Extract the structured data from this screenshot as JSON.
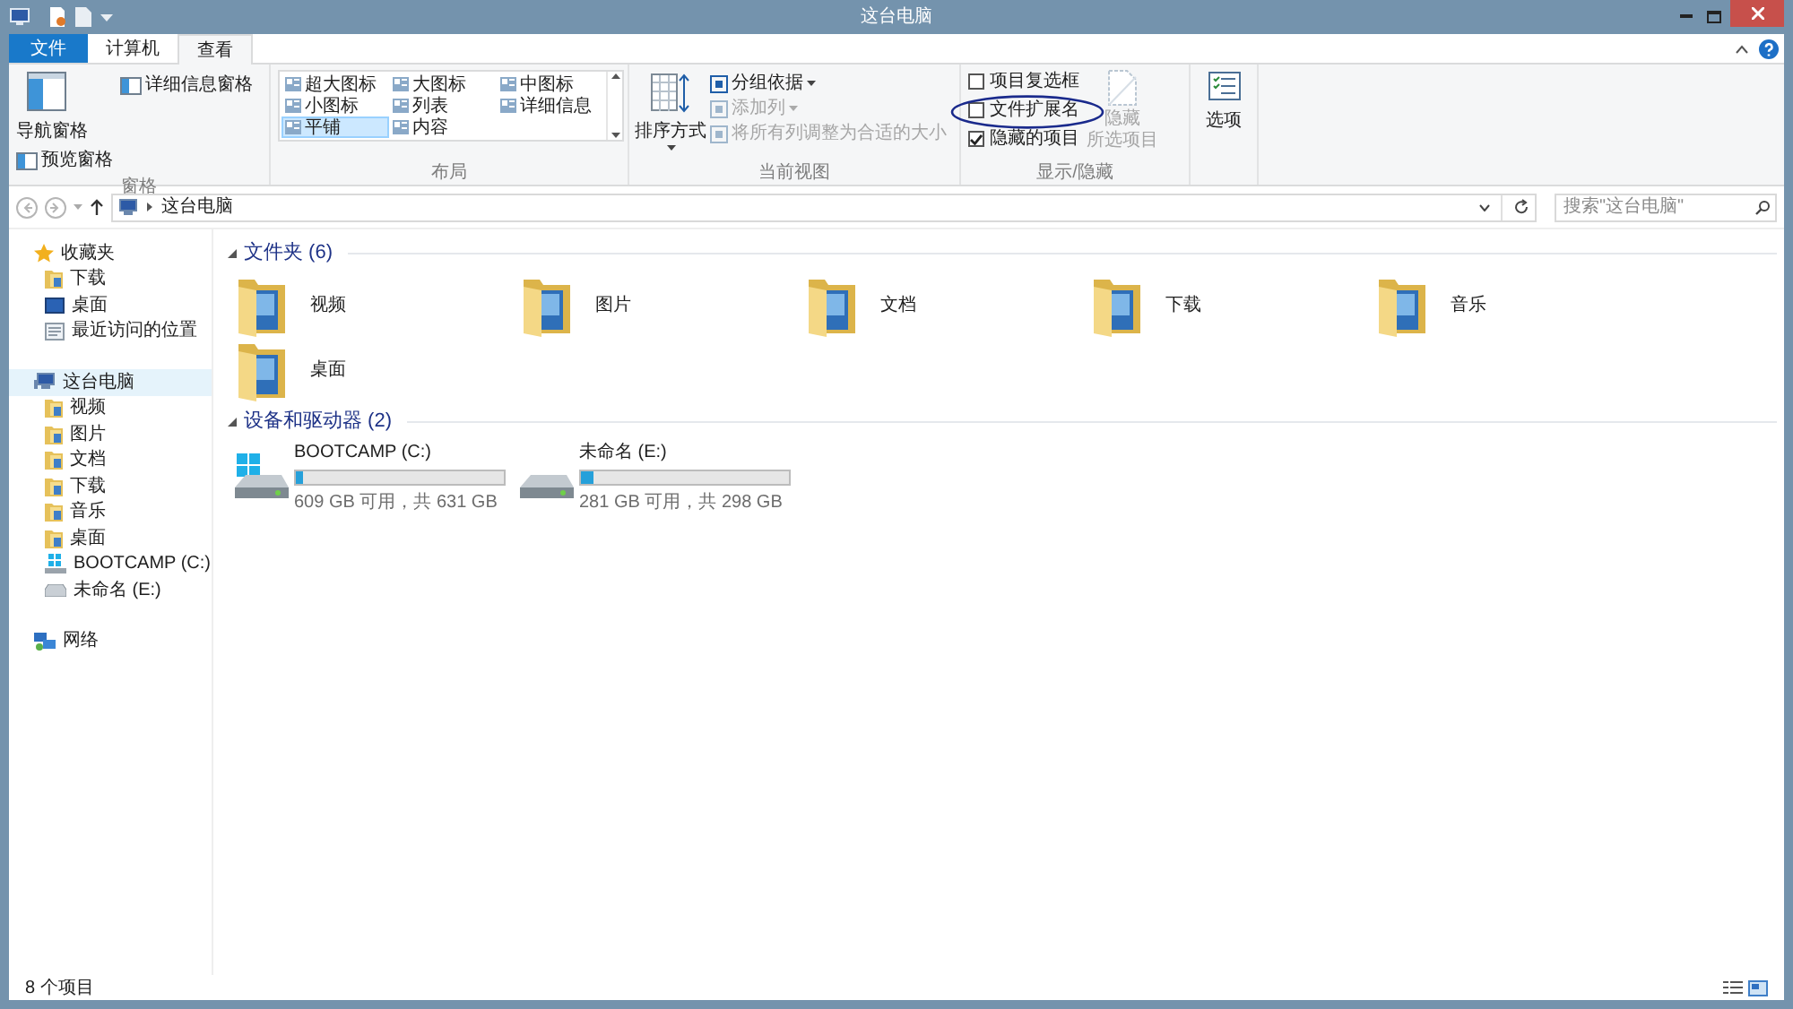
{
  "window": {
    "title": "这台电脑"
  },
  "tabs": [
    {
      "label": "文件",
      "kind": "file",
      "selected": false
    },
    {
      "label": "计算机",
      "kind": "tab",
      "selected": false
    },
    {
      "label": "查看",
      "kind": "tab",
      "selected": true
    }
  ],
  "ribbon": {
    "panes": {
      "label": "窗格",
      "navigation_pane": "导航窗格",
      "details_pane": "详细信息窗格",
      "preview_pane": "预览窗格"
    },
    "layout": {
      "label": "布局",
      "options": [
        {
          "label": "超大图标",
          "selected": false
        },
        {
          "label": "大图标",
          "selected": false
        },
        {
          "label": "中图标",
          "selected": false
        },
        {
          "label": "小图标",
          "selected": false
        },
        {
          "label": "列表",
          "selected": false
        },
        {
          "label": "详细信息",
          "selected": false
        },
        {
          "label": "平铺",
          "selected": true
        },
        {
          "label": "内容",
          "selected": false
        }
      ]
    },
    "current_view": {
      "label": "当前视图",
      "sort_by": "排序方式",
      "commands": [
        {
          "label": "分组依据",
          "disabled": false,
          "dropdown": true
        },
        {
          "label": "添加列",
          "disabled": true,
          "dropdown": true
        },
        {
          "label": "将所有列调整为合适的大小",
          "disabled": true,
          "dropdown": false
        }
      ]
    },
    "show_hide": {
      "label": "显示/隐藏",
      "checkboxes": [
        {
          "label": "项目复选框",
          "checked": false
        },
        {
          "label": "文件扩展名",
          "checked": false
        },
        {
          "label": "隐藏的项目",
          "checked": true
        }
      ],
      "hide_selected": {
        "lines": [
          "隐藏",
          "所选项目"
        ],
        "disabled": true
      }
    },
    "options": "选项"
  },
  "address_bar": {
    "path": "这台电脑",
    "search_placeholder": "搜索\"这台电脑\""
  },
  "sidebar": [
    {
      "label": "收藏夹",
      "kind": "star",
      "selected": false,
      "children": [
        {
          "label": "下载",
          "kind": "folder",
          "selected": false
        },
        {
          "label": "桌面",
          "kind": "desktop",
          "selected": false
        },
        {
          "label": "最近访问的位置",
          "kind": "recent",
          "selected": false
        }
      ]
    },
    {
      "label": "这台电脑",
      "kind": "computer",
      "selected": true,
      "children": [
        {
          "label": "视频",
          "kind": "folder",
          "selected": false
        },
        {
          "label": "图片",
          "kind": "folder",
          "selected": false
        },
        {
          "label": "文档",
          "kind": "folder",
          "selected": false
        },
        {
          "label": "下载",
          "kind": "folder",
          "selected": false
        },
        {
          "label": "音乐",
          "kind": "folder",
          "selected": false
        },
        {
          "label": "桌面",
          "kind": "folder",
          "selected": false
        },
        {
          "label": "BOOTCAMP (C:)",
          "kind": "windows_drive",
          "selected": false
        },
        {
          "label": "未命名 (E:)",
          "kind": "drive",
          "selected": false
        }
      ]
    },
    {
      "label": "网络",
      "kind": "network",
      "selected": false
    }
  ],
  "sections": [
    {
      "title": "文件夹 (6)",
      "kind": "folders",
      "items": [
        {
          "label": "视频"
        },
        {
          "label": "图片"
        },
        {
          "label": "文档"
        },
        {
          "label": "下载"
        },
        {
          "label": "音乐"
        },
        {
          "label": "桌面"
        }
      ]
    },
    {
      "title": "设备和驱动器 (2)",
      "kind": "drives",
      "items": [
        {
          "label": "BOOTCAMP (C:)",
          "kind": "windows_drive",
          "level": 0.035,
          "free": "609 GB 可用，共 631 GB"
        },
        {
          "label": "未命名 (E:)",
          "kind": "drive",
          "level": 0.057,
          "free": "281 GB 可用，共 298 GB"
        }
      ]
    }
  ],
  "status_bar": {
    "count": "8 个项目"
  }
}
